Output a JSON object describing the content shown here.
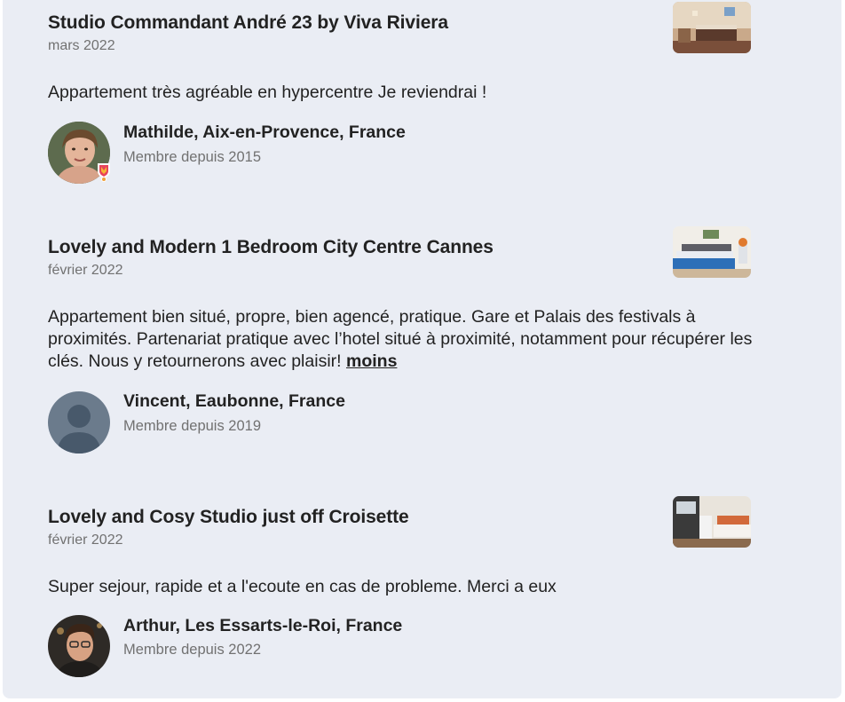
{
  "reviews": [
    {
      "listing_title": "Studio Commandant André 23 by Viva Riviera",
      "date": "mars 2022",
      "text": "Appartement très agréable en hypercentre Je reviendrai !",
      "reviewer": "Mathilde, Aix-en-Provence, France",
      "member_since": "Membre depuis 2015"
    },
    {
      "listing_title": "Lovely and Modern 1 Bedroom City Centre Cannes",
      "date": "février 2022",
      "text": "Appartement bien situé, propre, bien agencé, pratique. Gare et Palais des festivals à proximités. Partenariat pratique avec l’hotel situé à proximité, notamment pour récupérer les clés. Nous y retournerons avec plaisir!",
      "less_link": "moins",
      "reviewer": "Vincent, Eaubonne, France",
      "member_since": "Membre depuis 2019"
    },
    {
      "listing_title": "Lovely and Cosy Studio just off Croisette",
      "date": "février 2022",
      "text": "Super sejour, rapide et a l'ecoute en cas de probleme. Merci a eux",
      "reviewer": "Arthur, Les Essarts-le-Roi, France",
      "member_since": "Membre depuis 2022"
    }
  ],
  "colors": {
    "background": "#eaedf4",
    "text_primary": "#222222",
    "text_secondary": "#717171",
    "superhost_badge": "#e8445a"
  }
}
